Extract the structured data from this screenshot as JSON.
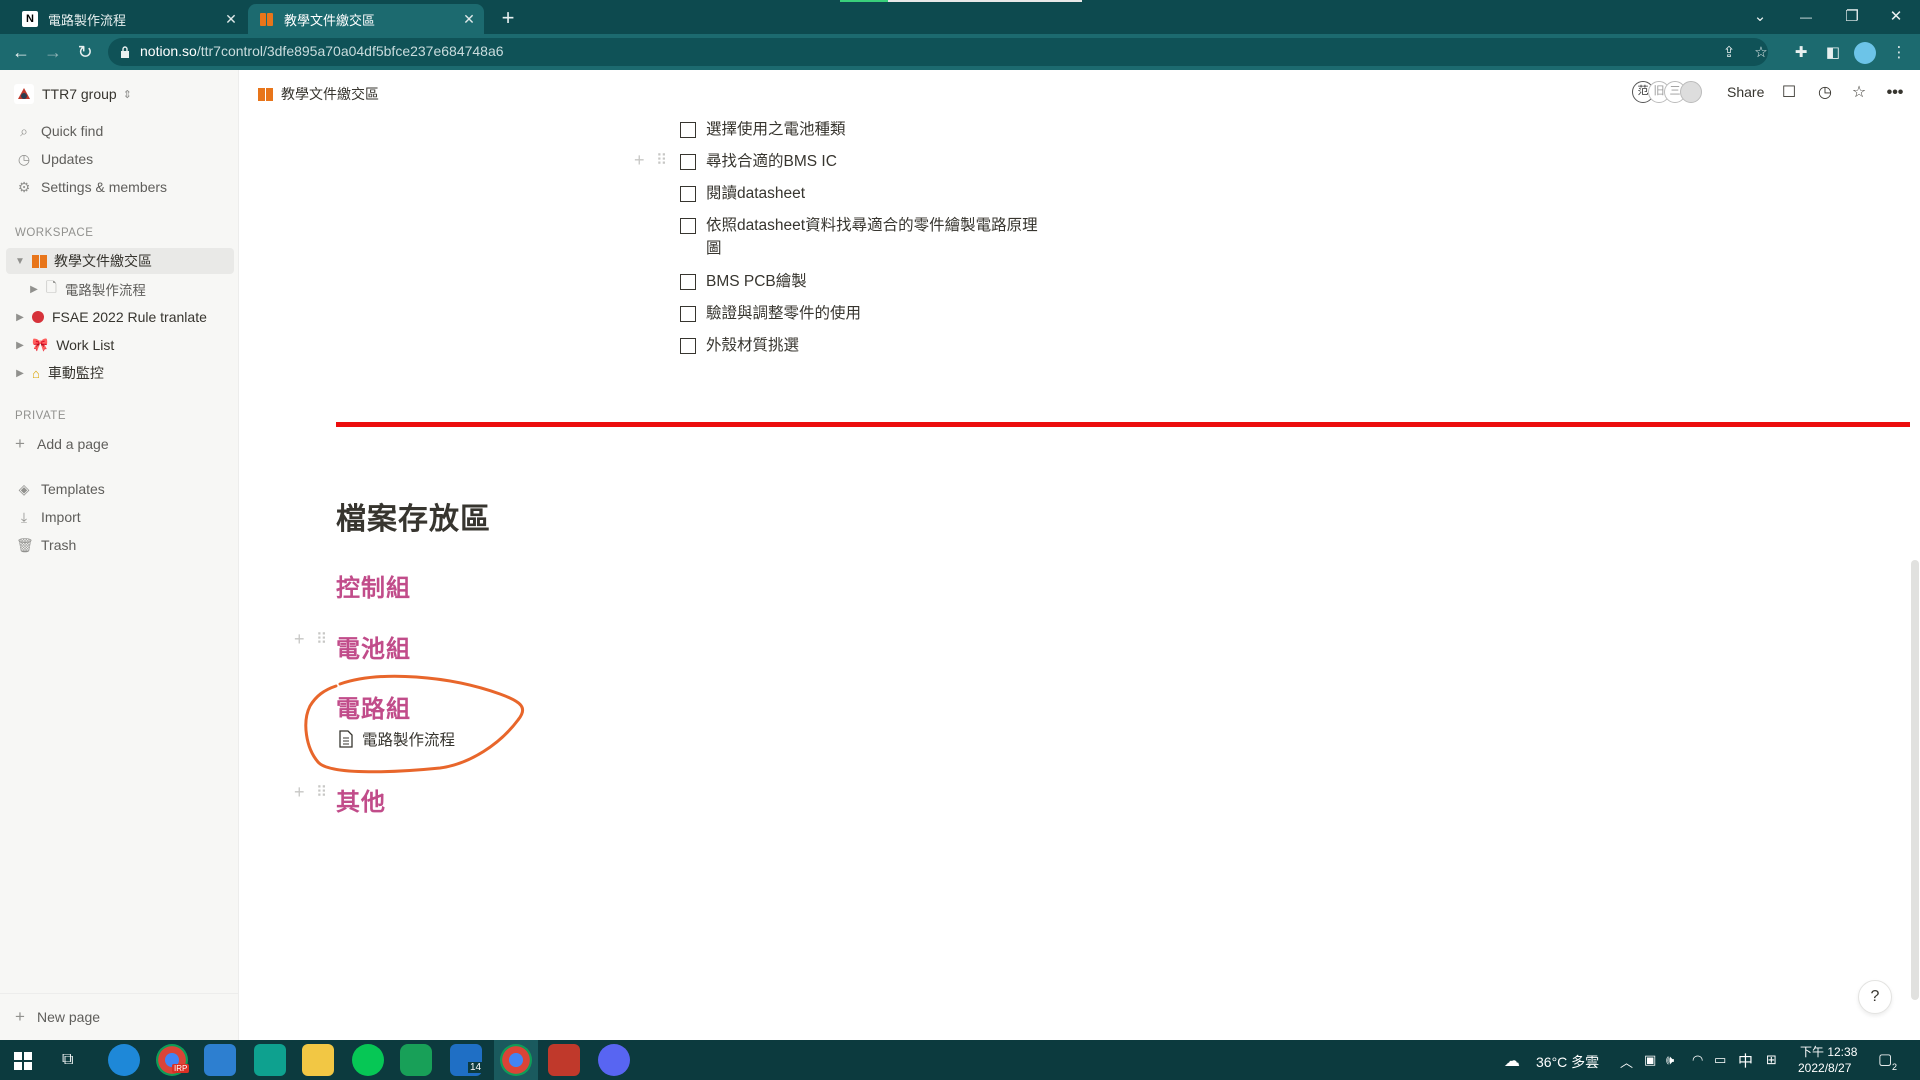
{
  "browser": {
    "tabs": [
      {
        "title": "電路製作流程",
        "close": "✕"
      },
      {
        "title": "教學文件繳交區",
        "close": "✕"
      }
    ],
    "new_tab": "+",
    "url_host": "notion.so",
    "url_path": "/ttr7control/3dfe895a70a04df5bfce237e684748a6",
    "window_controls": {
      "list": "⌄",
      "minimize": "—",
      "restore": "❐",
      "close": "✕"
    }
  },
  "sidebar": {
    "workspace_name": "TTR7 group",
    "nav": [
      {
        "label": "Quick find",
        "icon": "search-icon"
      },
      {
        "label": "Updates",
        "icon": "clock-icon"
      },
      {
        "label": "Settings & members",
        "icon": "gear-icon"
      }
    ],
    "workspace_section": "WORKSPACE",
    "workspace_pages": [
      {
        "label": "教學文件繳交區",
        "icon": "book-icon"
      },
      {
        "label": "電路製作流程",
        "icon": "document-icon"
      },
      {
        "label": "FSAE 2022 Rule tranlate",
        "icon": "pin-icon"
      },
      {
        "label": "Work List",
        "icon": "ribbon-icon"
      },
      {
        "label": "車動監控",
        "icon": "construction-icon"
      }
    ],
    "private_section": "PRIVATE",
    "add_page": "Add a page",
    "tools": [
      {
        "label": "Templates",
        "icon": "templates-icon"
      },
      {
        "label": "Import",
        "icon": "import-icon"
      },
      {
        "label": "Trash",
        "icon": "trash-icon"
      }
    ],
    "new_page": "New page"
  },
  "topbar": {
    "breadcrumb": "教學文件繳交區",
    "share": "Share",
    "collaborators": [
      "范",
      "旧",
      "三"
    ]
  },
  "content": {
    "todos": [
      {
        "text": "選擇使用之電池種類",
        "checked": false
      },
      {
        "text": "尋找合適的BMS IC",
        "checked": false
      },
      {
        "text": "閱讀datasheet",
        "checked": false
      },
      {
        "text": "依照datasheet資料找尋適合的零件繪製電路原理圖",
        "checked": false
      },
      {
        "text": "BMS PCB繪製",
        "checked": false
      },
      {
        "text": "驗證與調整零件的使用",
        "checked": false
      },
      {
        "text": "外殼材質挑選",
        "checked": false
      }
    ],
    "divider_color": "#ec0d0d",
    "section_title": "檔案存放區",
    "groups": [
      "控制組",
      "電池組",
      "電路組",
      "其他"
    ],
    "subpage_link": "電路製作流程",
    "annotation_color": "#e8662b",
    "heading_color": "#c14c8a",
    "help": "?"
  },
  "taskbar": {
    "chrome_badge": "IRP",
    "mail_badge": "14",
    "weather": "36°C 多雲",
    "ime": "中",
    "time": "下午 12:38",
    "date": "2022/8/27",
    "notif_count": "2"
  }
}
